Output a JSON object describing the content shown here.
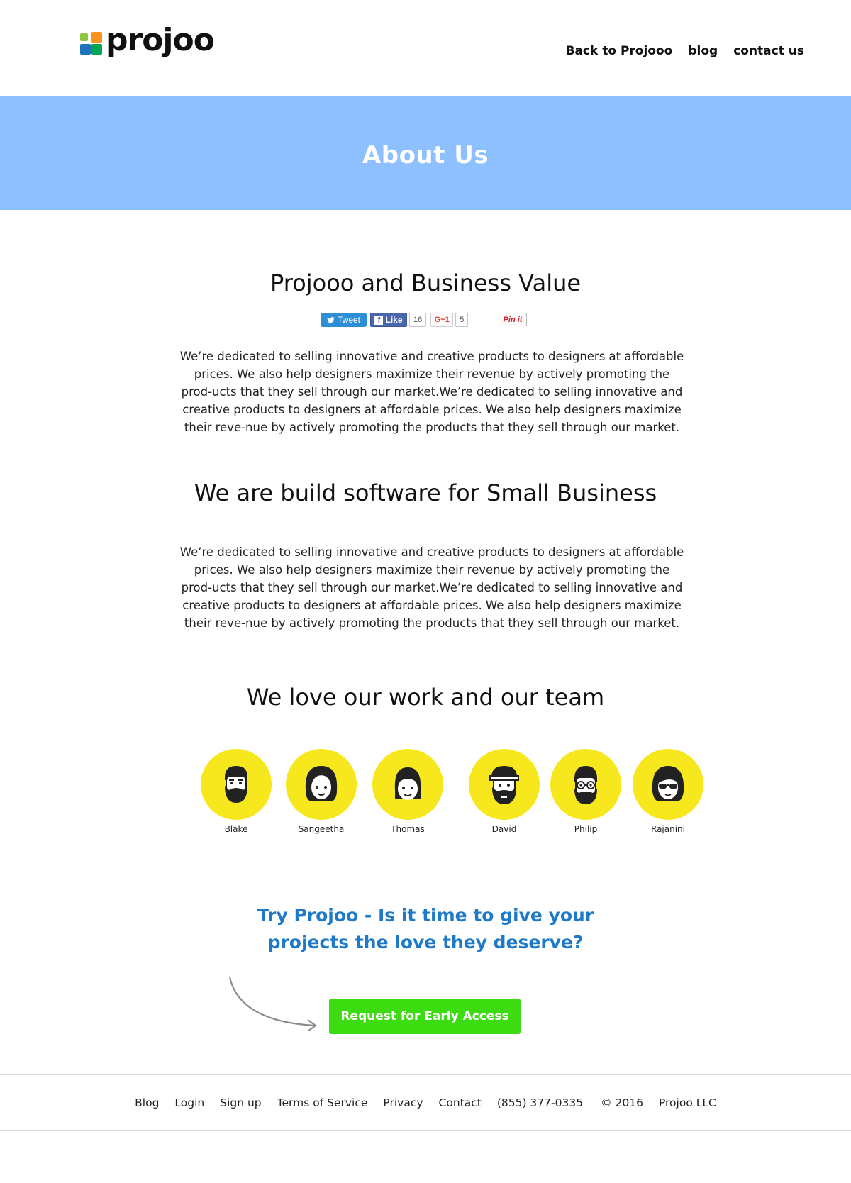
{
  "header": {
    "logo_text": "projoo",
    "nav": [
      "Back to Projooo",
      "blog",
      "contact us"
    ]
  },
  "hero": {
    "title": "About Us"
  },
  "section1": {
    "title": "Projooo and Business Value",
    "share": {
      "tweet": "Tweet",
      "like": "Like",
      "like_count": "16",
      "gplus": "G+1",
      "gplus_count": "5",
      "pin": "Pin it"
    },
    "body": "We’re dedicated to selling innovative and creative products to designers at affordable prices. We also help designers maximize their revenue by actively promoting the prod-ucts that they sell through our market.We’re dedicated to selling innovative and creative products to designers at affordable prices. We also help designers maximize their reve-nue by actively promoting the products that they sell through our market."
  },
  "section2": {
    "title": "We are build software for Small Business",
    "body": "We’re dedicated to selling innovative and creative products to designers at affordable prices. We also help designers maximize their revenue by actively promoting the prod-ucts that they sell through our market.We’re dedicated to selling innovative and creative products to designers at affordable prices. We also help designers maximize their reve-nue by actively promoting the products that they sell through our market."
  },
  "team": {
    "title": "We love our work and our team",
    "members": [
      {
        "name": "Blake",
        "icon": "bearded-man-avatar-icon"
      },
      {
        "name": "Sangeetha",
        "icon": "woman-avatar-icon"
      },
      {
        "name": "Thomas",
        "icon": "young-person-avatar-icon"
      },
      {
        "name": "David",
        "icon": "cap-bearded-man-avatar-icon"
      },
      {
        "name": "Philip",
        "icon": "glasses-bearded-man-avatar-icon"
      },
      {
        "name": "Rajanini",
        "icon": "sunglasses-woman-avatar-icon"
      }
    ],
    "avatar_color": "#f6e81d"
  },
  "cta": {
    "line1": "Try Projoo  - Is it time to give your",
    "line2": "projects the love they deserve?",
    "button": "Request for Early Access",
    "button_color": "#3ddc10",
    "text_color": "#1e7ac8"
  },
  "footer": {
    "links": [
      "Blog",
      "Login",
      "Sign up",
      "Terms of Service",
      "Privacy",
      "Contact"
    ],
    "phone": "(855) 377-0335",
    "copyright": "© 2016",
    "company": "Projoo LLC"
  },
  "colors": {
    "hero_bg": "#8ec0ff"
  }
}
